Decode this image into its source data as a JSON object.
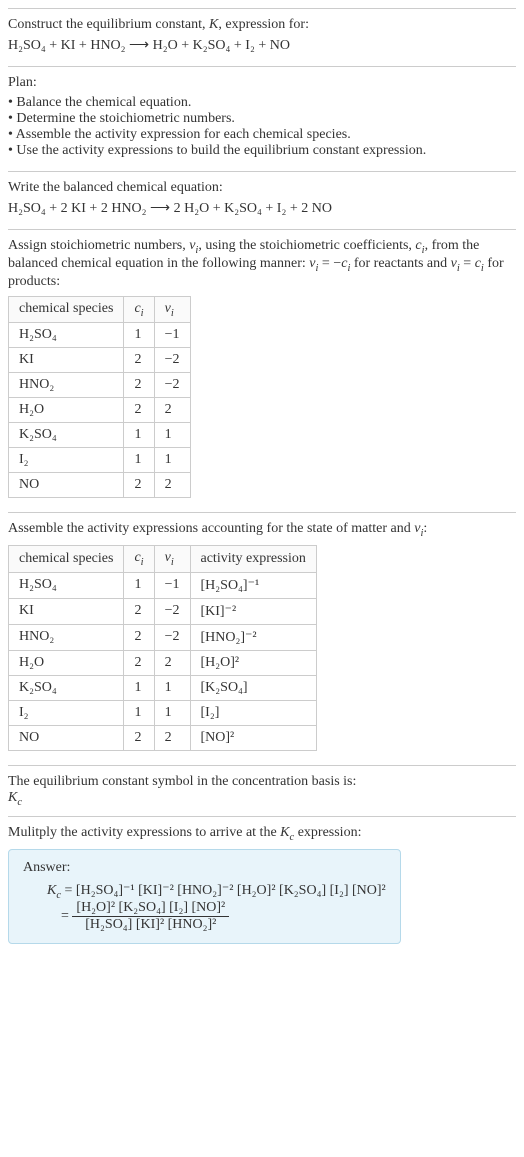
{
  "title": {
    "line1": "Construct the equilibrium constant, K, expression for:",
    "eq": "H₂SO₄ + KI + HNO₂ ⟶ H₂O + K₂SO₄ + I₂ + NO"
  },
  "plan": {
    "heading": "Plan:",
    "items": [
      "Balance the chemical equation.",
      "Determine the stoichiometric numbers.",
      "Assemble the activity expression for each chemical species.",
      "Use the activity expressions to build the equilibrium constant expression."
    ]
  },
  "balanced": {
    "heading": "Write the balanced chemical equation:",
    "eq": "H₂SO₄ + 2 KI + 2 HNO₂ ⟶ 2 H₂O + K₂SO₄ + I₂ + 2 NO"
  },
  "stoich": {
    "heading": "Assign stoichiometric numbers, νᵢ, using the stoichiometric coefficients, cᵢ, from the balanced chemical equation in the following manner: νᵢ = −cᵢ for reactants and νᵢ = cᵢ for products:",
    "headers": [
      "chemical species",
      "cᵢ",
      "νᵢ"
    ],
    "rows": [
      [
        "H₂SO₄",
        "1",
        "−1"
      ],
      [
        "KI",
        "2",
        "−2"
      ],
      [
        "HNO₂",
        "2",
        "−2"
      ],
      [
        "H₂O",
        "2",
        "2"
      ],
      [
        "K₂SO₄",
        "1",
        "1"
      ],
      [
        "I₂",
        "1",
        "1"
      ],
      [
        "NO",
        "2",
        "2"
      ]
    ]
  },
  "activity": {
    "heading": "Assemble the activity expressions accounting for the state of matter and νᵢ:",
    "headers": [
      "chemical species",
      "cᵢ",
      "νᵢ",
      "activity expression"
    ],
    "rows": [
      [
        "H₂SO₄",
        "1",
        "−1",
        "[H₂SO₄]⁻¹"
      ],
      [
        "KI",
        "2",
        "−2",
        "[KI]⁻²"
      ],
      [
        "HNO₂",
        "2",
        "−2",
        "[HNO₂]⁻²"
      ],
      [
        "H₂O",
        "2",
        "2",
        "[H₂O]²"
      ],
      [
        "K₂SO₄",
        "1",
        "1",
        "[K₂SO₄]"
      ],
      [
        "I₂",
        "1",
        "1",
        "[I₂]"
      ],
      [
        "NO",
        "2",
        "2",
        "[NO]²"
      ]
    ]
  },
  "symbol": {
    "heading": "The equilibrium constant symbol in the concentration basis is:",
    "value": "K_c"
  },
  "multiply": {
    "heading": "Mulitply the activity expressions to arrive at the K_c expression:"
  },
  "answer": {
    "label": "Answer:",
    "line1_lhs": "K_c = ",
    "line1_rhs": "[H₂SO₄]⁻¹ [KI]⁻² [HNO₂]⁻² [H₂O]² [K₂SO₄] [I₂] [NO]²",
    "line2_eq": "= ",
    "frac_num": "[H₂O]² [K₂SO₄] [I₂] [NO]²",
    "frac_den": "[H₂SO₄] [KI]² [HNO₂]²"
  }
}
